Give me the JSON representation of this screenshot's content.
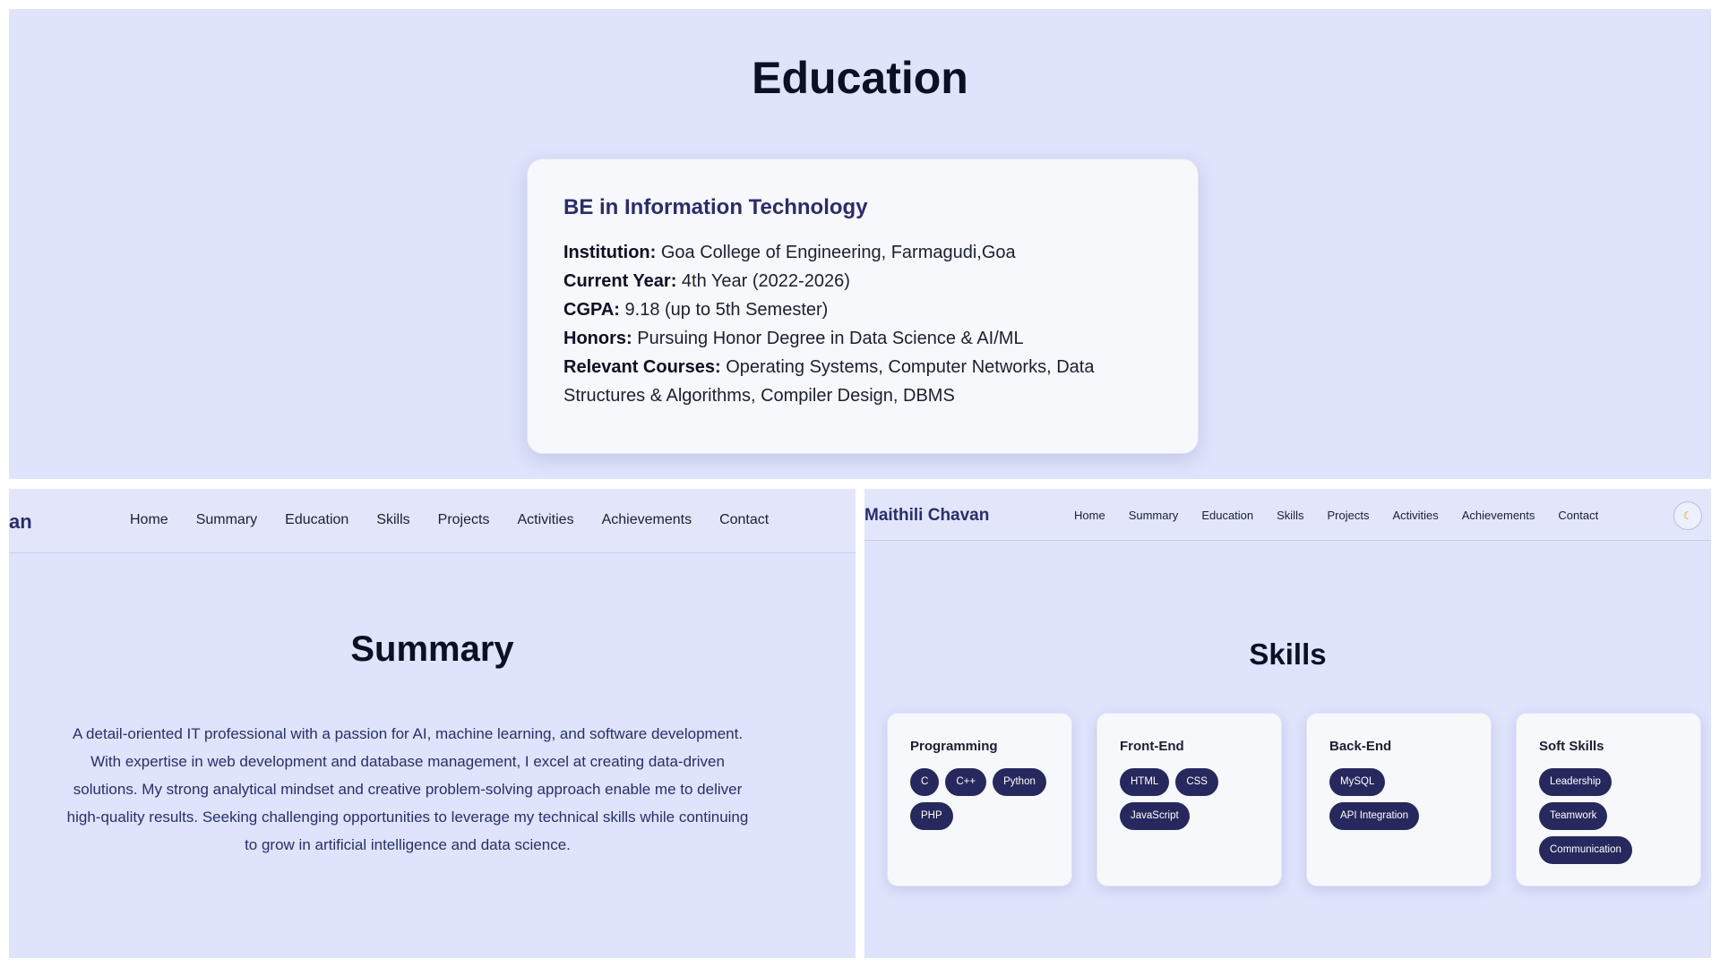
{
  "education": {
    "title": "Education",
    "degree": "BE in Information Technology",
    "institution_label": "Institution:",
    "institution": "Goa College of Engineering, Farmagudi,Goa",
    "year_label": "Current Year:",
    "year": "4th Year (2022-2026)",
    "cgpa_label": "CGPA:",
    "cgpa": "9.18 (up to 5th Semester)",
    "honors_label": "Honors:",
    "honors": "Pursuing Honor Degree in Data Science & AI/ML",
    "courses_label": "Relevant Courses:",
    "courses_line1": "Operating Systems, Computer Networks, Data",
    "courses_line2": "Structures & Algorithms, Compiler Design, DBMS"
  },
  "summary_panel": {
    "brand_fragment": "an",
    "nav": [
      "Home",
      "Summary",
      "Education",
      "Skills",
      "Projects",
      "Activities",
      "Achievements",
      "Contact"
    ],
    "title": "Summary",
    "lines": [
      "A detail-oriented IT professional with a passion for AI, machine learning, and software development.",
      "With expertise in web development and database management, I excel at creating data-driven",
      "solutions. My strong analytical mindset and creative problem-solving approach enable me to deliver",
      "high-quality results. Seeking challenging opportunities to leverage my technical skills while continuing",
      "to grow in artificial intelligence and data science."
    ]
  },
  "skills_panel": {
    "brand": "Maithili Chavan",
    "nav": [
      "Home",
      "Summary",
      "Education",
      "Skills",
      "Projects",
      "Activities",
      "Achievements",
      "Contact"
    ],
    "theme_icon": "moon-icon",
    "theme_glyph": "☾",
    "title": "Skills",
    "cards": [
      {
        "title": "Programming",
        "chips": [
          "C",
          "C++",
          "Python",
          "PHP"
        ]
      },
      {
        "title": "Front-End",
        "chips": [
          "HTML",
          "CSS",
          "JavaScript"
        ]
      },
      {
        "title": "Back-End",
        "chips": [
          "MySQL",
          "API Integration"
        ]
      },
      {
        "title": "Soft Skills",
        "chips": [
          "Leadership",
          "Teamwork",
          "Communication"
        ]
      }
    ]
  },
  "colors": {
    "panel_bg": "#dfe3fc",
    "card_bg": "#f7f8fb",
    "chip_bg": "#27285e",
    "accent_text": "#2a2d6b"
  }
}
